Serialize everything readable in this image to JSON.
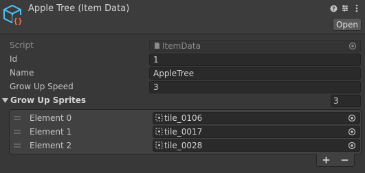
{
  "header": {
    "title": "Apple Tree (Item Data)",
    "open_label": "Open",
    "icons": [
      "help-icon",
      "preset-icon",
      "more-options-icon"
    ]
  },
  "fields": {
    "script": {
      "label": "Script",
      "value": "ItemData"
    },
    "id": {
      "label": "Id",
      "value": "1"
    },
    "name": {
      "label": "Name",
      "value": "AppleTree"
    },
    "grow_up_speed": {
      "label": "Grow Up Speed",
      "value": "3"
    }
  },
  "grow_up_sprites": {
    "label": "Grow Up Sprites",
    "size": "3",
    "elements": [
      {
        "label": "Element 0",
        "value": "tile_0106"
      },
      {
        "label": "Element 1",
        "value": "tile_0017"
      },
      {
        "label": "Element 2",
        "value": "tile_0028"
      }
    ],
    "add_label": "+",
    "remove_label": "−"
  },
  "colors": {
    "background": "#383838",
    "field": "#2a2a2a",
    "icon_blue": "#4fc3f7",
    "icon_orange": "#ff7043"
  }
}
